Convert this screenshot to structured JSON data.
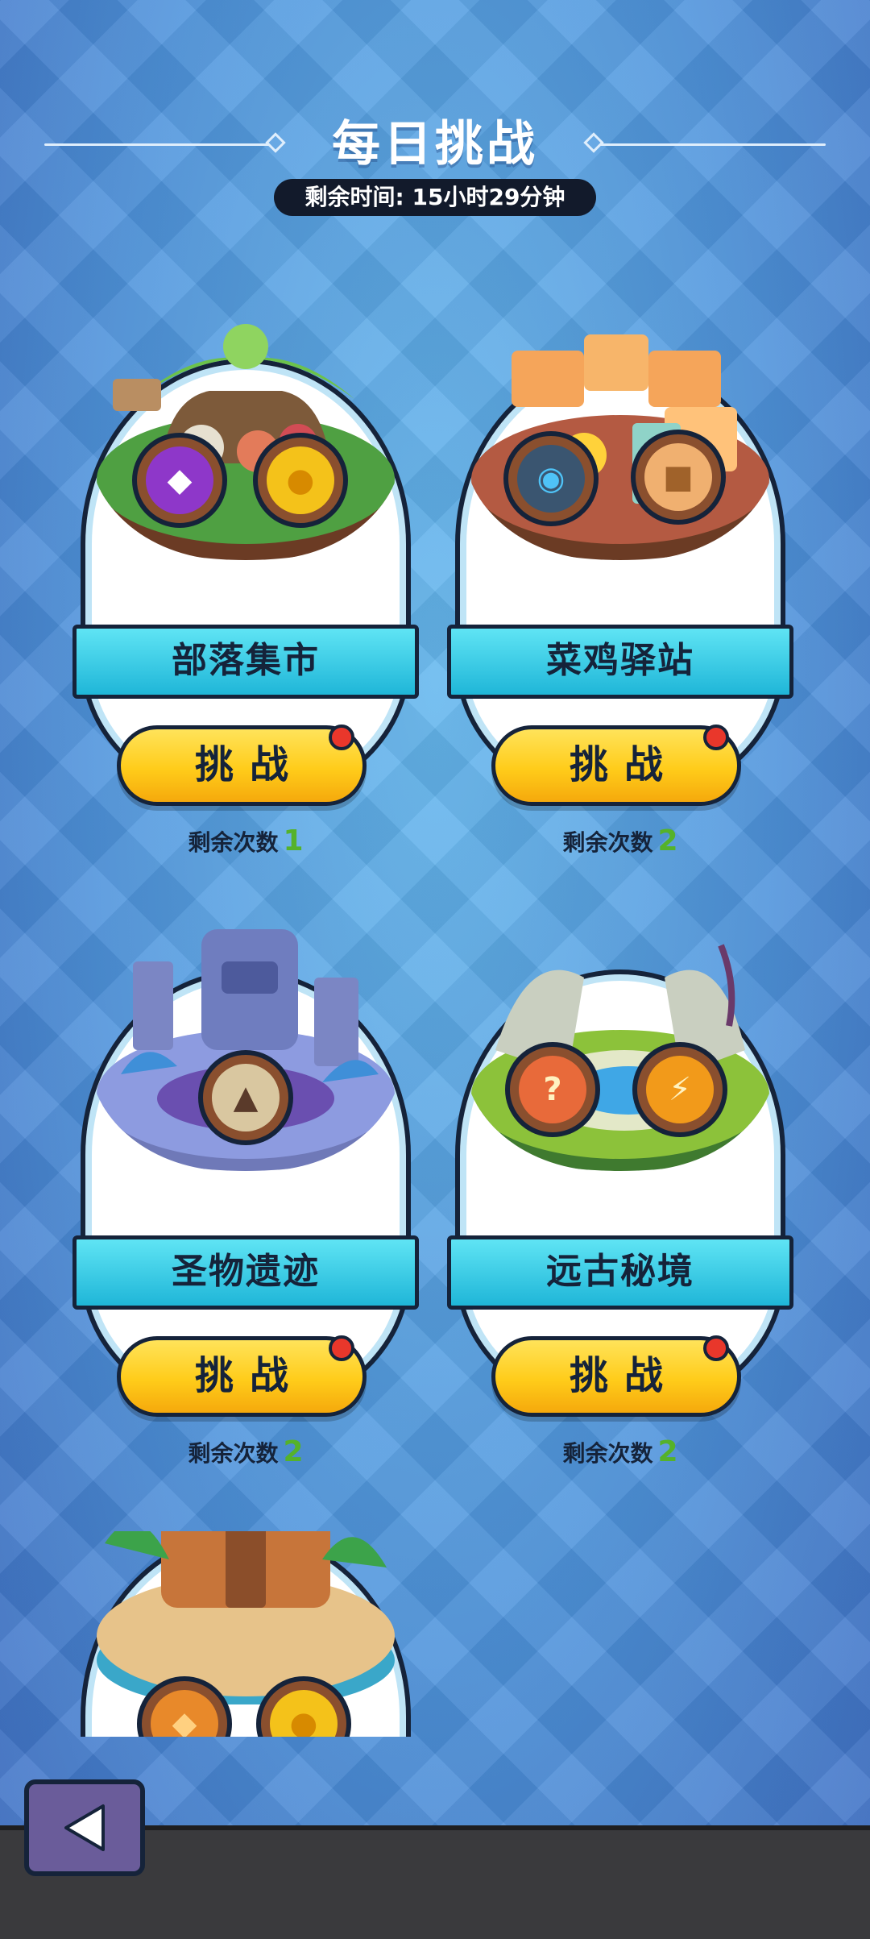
{
  "header": {
    "title": "每日挑战",
    "timer": "剩余时间: 15小时29分钟"
  },
  "labels": {
    "challenge": "挑战",
    "remaining": "剩余次数"
  },
  "cards": [
    {
      "name": "部落集市",
      "remaining": "1",
      "icons": [
        "purple-gem-icon",
        "gold-coin-icon"
      ]
    },
    {
      "name": "菜鸡驿站",
      "remaining": "2",
      "icons": [
        "blue-crystal-icon",
        "box-icon"
      ]
    },
    {
      "name": "圣物遗迹",
      "remaining": "2",
      "icons": [
        "relic-scroll-icon"
      ]
    },
    {
      "name": "远古秘境",
      "remaining": "2",
      "icons": [
        "mystery-chest-icon",
        "orange-coin-icon"
      ]
    }
  ],
  "colors": {
    "background": "#4a8fd6",
    "banner": "#1fb6d8",
    "button": "#ffcc1a",
    "count_number": "#55b22a",
    "notify_dot": "#e9372b"
  }
}
